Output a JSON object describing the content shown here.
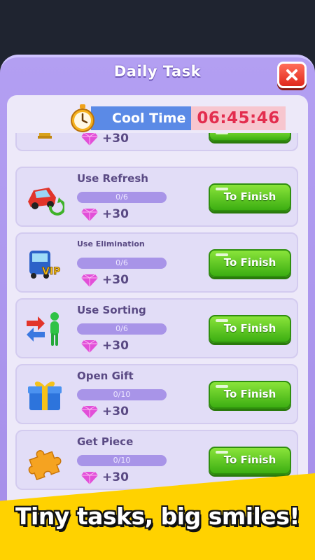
{
  "dialog": {
    "title": "Daily Task"
  },
  "timer": {
    "label": "Cool Time",
    "value": "06:45:46"
  },
  "tasks": [
    {
      "name": "",
      "progress": "",
      "reward": "+30",
      "button": "",
      "icon": "trophy-icon"
    },
    {
      "name": "Use Refresh",
      "progress": "0/6",
      "reward": "+30",
      "button": "To Finish",
      "icon": "car-refresh-icon"
    },
    {
      "name": "Use Elimination",
      "progress": "0/6",
      "reward": "+30",
      "button": "To Finish",
      "icon": "vip-bus-icon"
    },
    {
      "name": "Use Sorting",
      "progress": "0/6",
      "reward": "+30",
      "button": "To Finish",
      "icon": "sorting-figure-icon"
    },
    {
      "name": "Open Gift",
      "progress": "0/10",
      "reward": "+30",
      "button": "To Finish",
      "icon": "gift-box-icon"
    },
    {
      "name": "Get Piece",
      "progress": "0/10",
      "reward": "+30",
      "button": "To Finish",
      "icon": "puzzle-piece-icon"
    }
  ],
  "banner": {
    "caption": "Tiny tasks, big smiles!"
  },
  "colors": {
    "accent_green": "#3cae12",
    "panel_purple": "#a58ee9",
    "timer_red": "#e32d4e",
    "banner_yellow": "#ffd200"
  }
}
